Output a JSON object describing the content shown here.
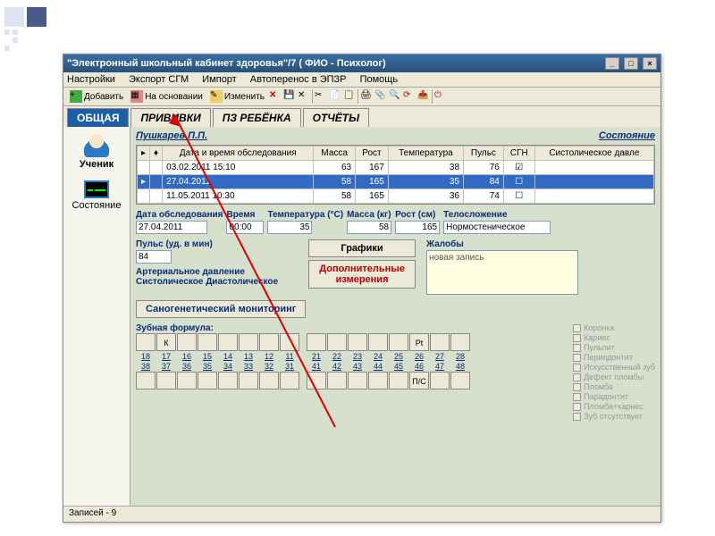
{
  "window": {
    "title": "\"Электронный школьный кабинет здоровья\"/7 ( ФИО - Психолог)"
  },
  "menu": {
    "settings": "Настройки",
    "export": "Экспорт СГМ",
    "import": "Импорт",
    "auto": "Автоперенос в ЭПЗР",
    "help": "Помощь"
  },
  "toolbar": {
    "add": "Добавить",
    "based": "На основании",
    "change": "Изменить"
  },
  "tabs": {
    "general": "ОБЩАЯ",
    "vaccines": "ПРИВИВКИ",
    "pz": "ПЗ РЕБЁНКА",
    "reports": "ОТЧЁТЫ"
  },
  "sidebar": {
    "student": "Ученик",
    "state": "Состояние"
  },
  "header": {
    "pupil": "Пушкарев П.П.",
    "status": "Состояние"
  },
  "grid": {
    "cols": {
      "datetime": "Дата и время обследования",
      "mass": "Масса",
      "height": "Рост",
      "temp": "Температура",
      "pulse": "Пульс",
      "sgn": "СГН",
      "sys": "Систолическое давле"
    },
    "rows": [
      {
        "dt": "03.02.2011 15:10",
        "mass": "63",
        "height": "167",
        "temp": "38",
        "pulse": "76",
        "sgn": "✓"
      },
      {
        "dt": "27.04.2011",
        "mass": "58",
        "height": "165",
        "temp": "35",
        "pulse": "84",
        "sgn": ""
      },
      {
        "dt": "11.05.2011 10:30",
        "mass": "58",
        "height": "165",
        "temp": "36",
        "pulse": "74",
        "sgn": ""
      }
    ]
  },
  "form": {
    "date_lbl": "Дата обследования",
    "time_lbl": "Время",
    "temp_lbl": "Температура (°C)",
    "mass_lbl": "Масса (кг)",
    "height_lbl": "Рост (см)",
    "body_lbl": "Телосложение",
    "pulse_lbl": "Пульс (уд. в мин)",
    "bp_lbl": "Артериальное давление",
    "sys_lbl": "Систолическое",
    "dia_lbl": "Диастолическое",
    "complaints_lbl": "Жалобы",
    "date": "27.04.2011",
    "time": "00:00",
    "temp": "35",
    "mass": "58",
    "height": "165",
    "body": "Нормостеническое",
    "pulse": "84",
    "complaints": "новая запись"
  },
  "buttons": {
    "charts": "Графики",
    "extra": "Дополнительные измерения",
    "sano": "Саногенетический мониторинг"
  },
  "dental": {
    "label": "Зубная формула:",
    "marks": {
      "k": "К",
      "pt": "Pt",
      "ps": "П/С"
    },
    "top_nums": [
      "18",
      "17",
      "16",
      "15",
      "14",
      "13",
      "12",
      "11",
      "21",
      "22",
      "23",
      "24",
      "25",
      "26",
      "27",
      "28"
    ],
    "bot_nums": [
      "38",
      "37",
      "36",
      "35",
      "34",
      "33",
      "32",
      "31",
      "41",
      "42",
      "43",
      "44",
      "45",
      "46",
      "47",
      "48"
    ],
    "legend": [
      "Коронка",
      "Кариес",
      "Пульпит",
      "Периодонтит",
      "Искусственный зуб",
      "Дефект пломбы",
      "Пломба",
      "Парадонтит",
      "Пломба+кариес",
      "Зуб отсутствует"
    ]
  },
  "status": {
    "records": "Записей - 9"
  }
}
